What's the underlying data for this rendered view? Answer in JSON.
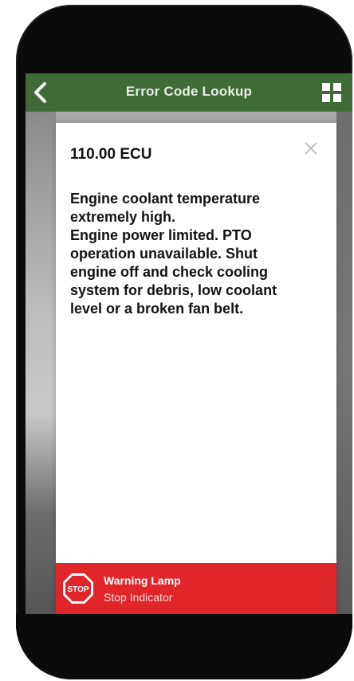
{
  "nav": {
    "title": "Error Code Lookup",
    "back_icon": "chevron-left-icon",
    "grid_icon": "grid-icon"
  },
  "modal": {
    "title": "110.00 ECU",
    "close_icon": "close-icon",
    "description_lines": [
      "Engine coolant temperature",
      "extremely high.",
      "Engine power limited. PTO",
      "operation unavailable.  Shut",
      "engine off and check cooling",
      "system for debris, low coolant",
      "level or a broken fan belt."
    ]
  },
  "warning": {
    "icon": "stop-sign-icon",
    "stop_text": "STOP",
    "title": "Warning Lamp",
    "subtitle": "Stop Indicator",
    "color": "#e0262b"
  },
  "colors": {
    "nav_bar": "#3f6b37",
    "nav_title": "#e7efe3",
    "warning": "#e0262b"
  }
}
